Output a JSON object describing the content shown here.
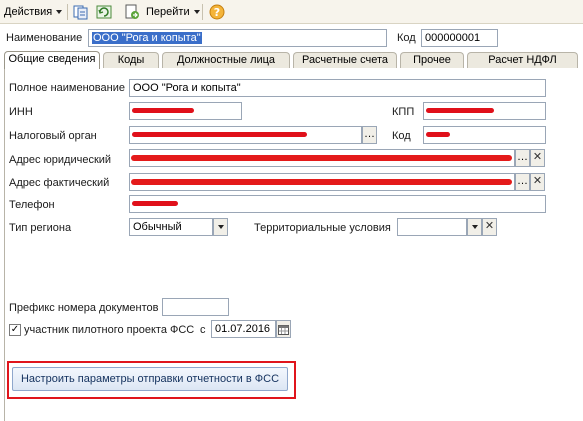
{
  "toolbar": {
    "actions_label": "Действия",
    "goto_label": "Перейти",
    "help_symbol": "?"
  },
  "header": {
    "name_label": "Наименование",
    "name_value": "ООО \"Рога и копыта\"",
    "code_label": "Код",
    "code_value": "000000001"
  },
  "tabs": [
    {
      "label": "Общие сведения"
    },
    {
      "label": "Коды"
    },
    {
      "label": "Должностные лица"
    },
    {
      "label": "Расчетные счета"
    },
    {
      "label": "Прочее"
    },
    {
      "label": "Расчет НДФЛ"
    }
  ],
  "form": {
    "full_name_label": "Полное наименование",
    "full_name_value": "ООО \"Рога и копыта\"",
    "inn_label": "ИНН",
    "kpp_label": "КПП",
    "tax_office_label": "Налоговый орган",
    "tax_code_label": "Код",
    "legal_address_label": "Адрес юридический",
    "actual_address_label": "Адрес фактический",
    "phone_label": "Телефон",
    "region_type_label": "Тип региона",
    "region_type_value": "Обычный",
    "territorial_label": "Территориальные условия",
    "doc_prefix_label": "Префикс номера документов",
    "fss_pilot_label": "участник пилотного проекта ФСС",
    "fss_pilot_checked": true,
    "fss_since_label": "с",
    "fss_date_value": "01.07.2016",
    "configure_button_label": "Настроить параметры отправки отчетности в ФСС"
  },
  "colors": {
    "highlight": "#3a6ec9",
    "redaction": "#e0101a",
    "callout_border": "#e0151c"
  }
}
